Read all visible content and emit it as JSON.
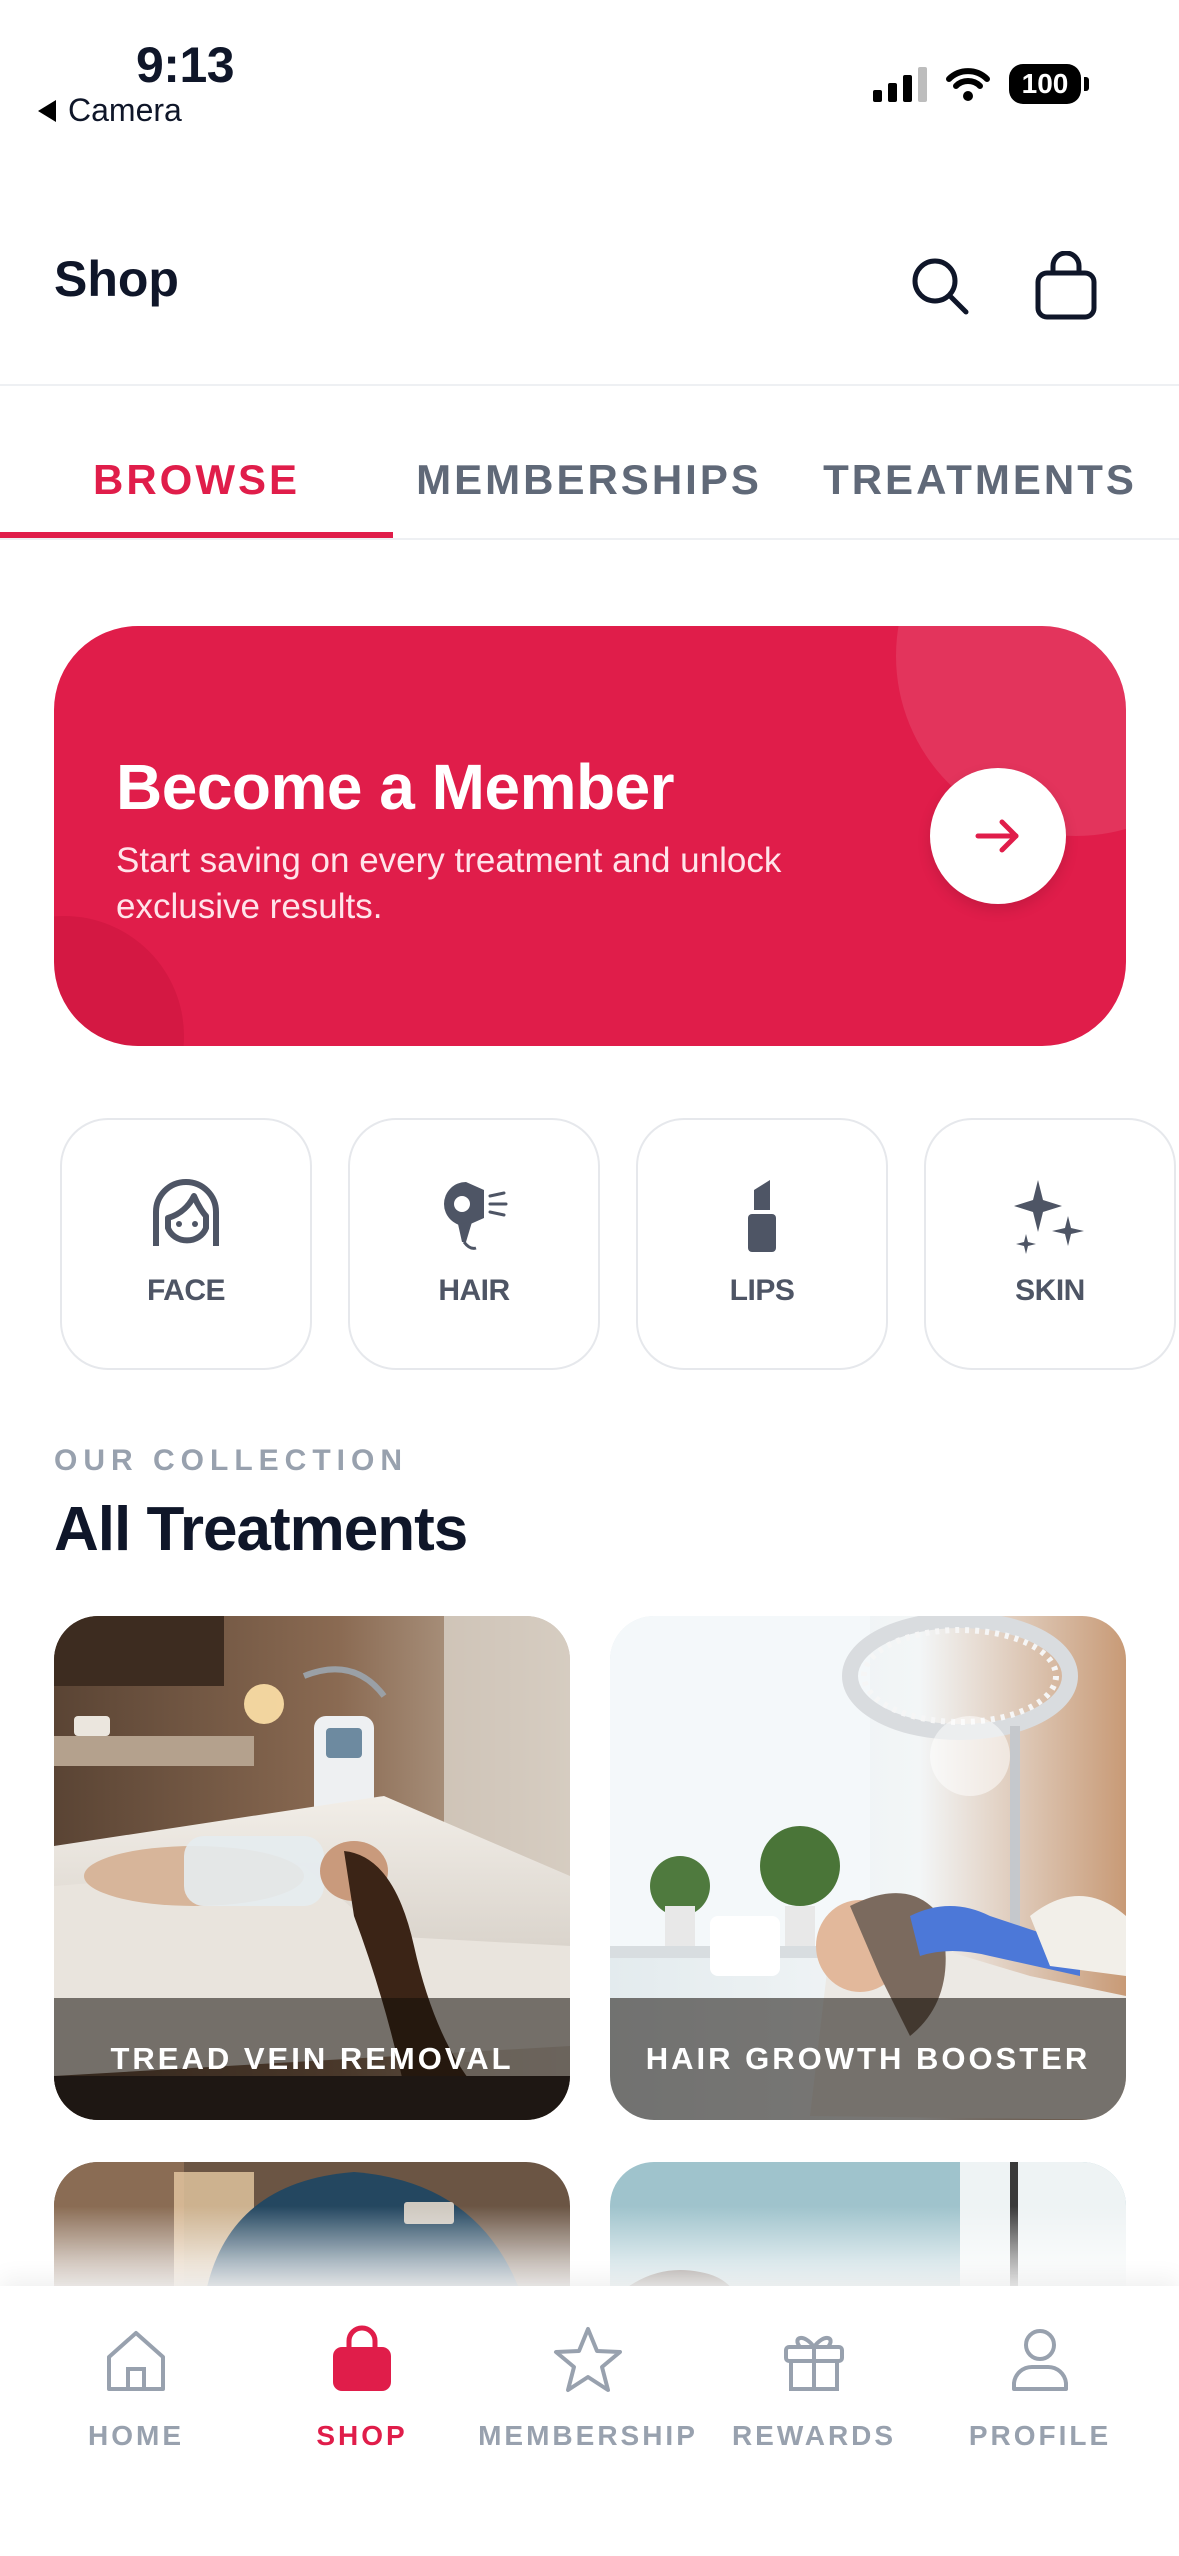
{
  "status_bar": {
    "time": "9:13",
    "back_label": "Camera",
    "battery": "100"
  },
  "header": {
    "title": "Shop",
    "search_icon": "search-icon",
    "bag_icon": "bag-icon"
  },
  "tabs": [
    {
      "label": "BROWSE",
      "active": true
    },
    {
      "label": "MEMBERSHIPS",
      "active": false
    },
    {
      "label": "TREATMENTS",
      "active": false
    }
  ],
  "banner": {
    "title": "Become a Member",
    "subtitle": "Start saving on every treatment and unlock exclusive results.",
    "arrow_icon": "arrow-right-icon"
  },
  "categories": [
    {
      "label": "FACE",
      "icon": "face-icon"
    },
    {
      "label": "HAIR",
      "icon": "hair-dryer-icon"
    },
    {
      "label": "LIPS",
      "icon": "lipstick-icon"
    },
    {
      "label": "SKIN",
      "icon": "sparkles-icon"
    }
  ],
  "collection": {
    "eyebrow": "OUR COLLECTION",
    "title": "All Treatments",
    "cards": [
      {
        "label": "TREAD VEIN REMOVAL"
      },
      {
        "label": "HAIR GROWTH BOOSTER"
      },
      {
        "label": ""
      },
      {
        "label": ""
      }
    ]
  },
  "bottom_nav": [
    {
      "label": "HOME",
      "icon": "home-icon",
      "active": false
    },
    {
      "label": "SHOP",
      "icon": "shopping-bag-icon",
      "active": true
    },
    {
      "label": "MEMBERSHIP",
      "icon": "star-icon",
      "active": false
    },
    {
      "label": "REWARDS",
      "icon": "gift-icon",
      "active": false
    },
    {
      "label": "PROFILE",
      "icon": "user-icon",
      "active": false
    }
  ],
  "colors": {
    "accent": "#e01d4a",
    "text_dark": "#0f1629",
    "muted": "#98a1ae",
    "icon_gray": "#4e5565"
  }
}
